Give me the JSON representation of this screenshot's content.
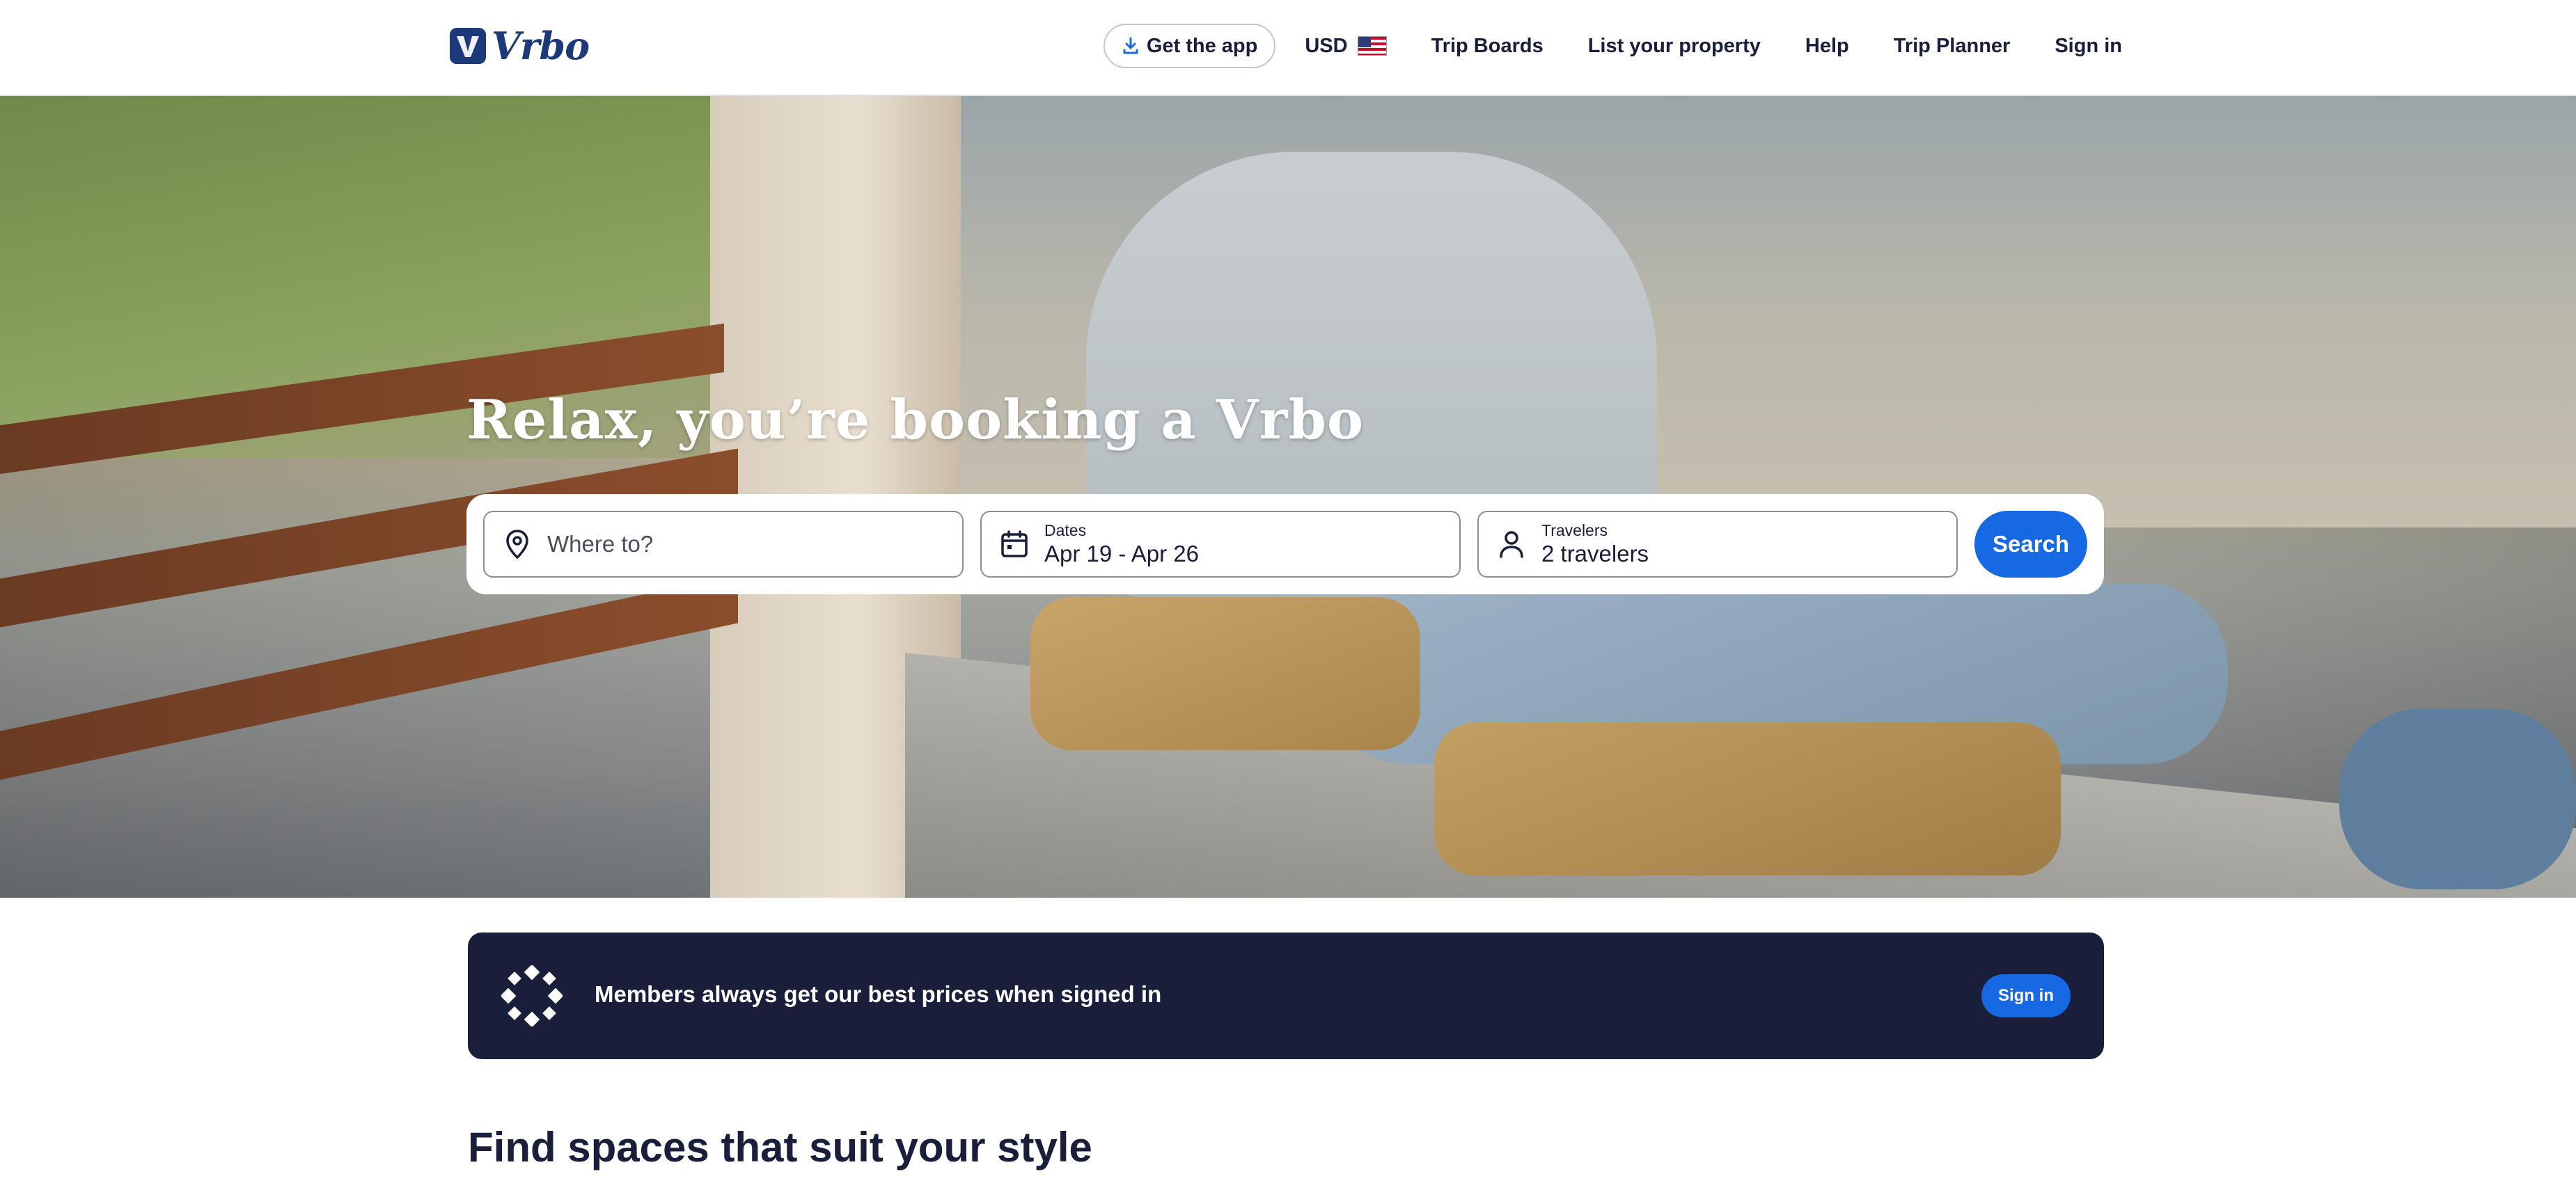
{
  "header": {
    "logo_text": "Vrbo",
    "get_app_label": "Get the app",
    "currency": "USD",
    "nav": [
      "Trip Boards",
      "List your property",
      "Help",
      "Trip Planner",
      "Sign in"
    ]
  },
  "hero": {
    "title": "Relax, you’re booking a Vrbo"
  },
  "search": {
    "destination_placeholder": "Where to?",
    "dates_label": "Dates",
    "dates_value": "Apr 19 - Apr 26",
    "travelers_label": "Travelers",
    "travelers_value": "2 travelers",
    "button_label": "Search"
  },
  "banner": {
    "text": "Members always get our best prices when signed in",
    "button_label": "Sign in"
  },
  "section": {
    "title": "Find spaces that suit your style"
  },
  "colors": {
    "brand_blue": "#1668e3",
    "navy": "#191e3b",
    "logo_blue": "#1c3a7a"
  },
  "icons": [
    "download-icon",
    "us-flag-icon",
    "location-pin-icon",
    "calendar-icon",
    "person-icon",
    "member-rewards-icon"
  ]
}
